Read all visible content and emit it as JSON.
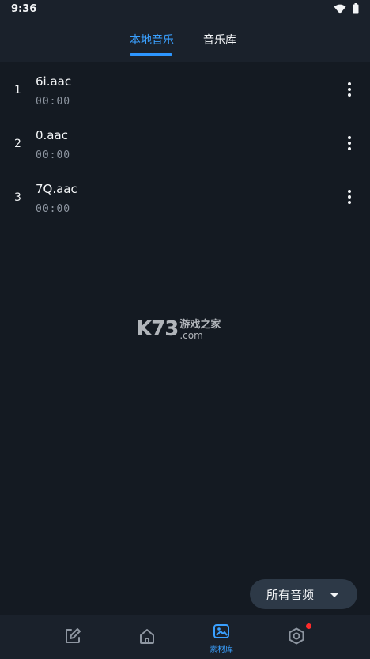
{
  "status": {
    "time": "9:36"
  },
  "tabs": {
    "local_label": "本地音乐",
    "library_label": "音乐库"
  },
  "tracks": [
    {
      "index": "1",
      "title": "6i.aac",
      "duration": "00:00"
    },
    {
      "index": "2",
      "title": "0.aac",
      "duration": "00:00"
    },
    {
      "index": "3",
      "title": "7Q.aac",
      "duration": "00:00"
    }
  ],
  "watermark": {
    "logo": "K73",
    "cn": "游戏之家",
    "com": ".com"
  },
  "filter": {
    "label": "所有音频"
  },
  "bottom_nav": {
    "materials_label": "素材库"
  },
  "colors": {
    "accent": "#3aa0ff",
    "background": "#141a22",
    "panel": "#1a212b",
    "badge": "#ff2b2b"
  }
}
